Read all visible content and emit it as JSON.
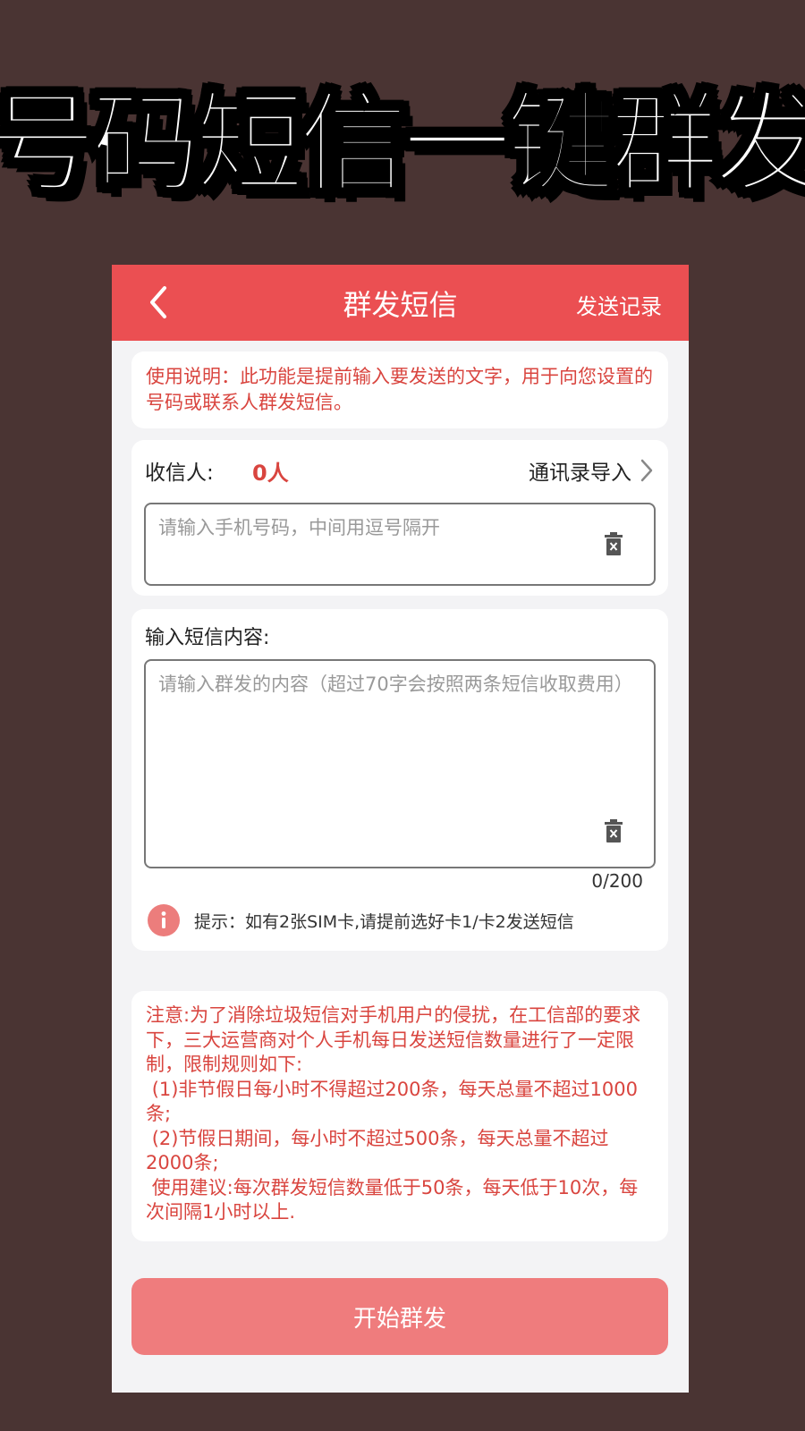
{
  "banner": {
    "title": "号码短信一键群发"
  },
  "header": {
    "title": "群发短信",
    "right_link": "发送记录"
  },
  "instructions": {
    "text": "使用说明：此功能是提前输入要发送的文字，用于向您设置的号码或联系人群发短信。"
  },
  "recipient": {
    "label": "收信人:",
    "count": "0人",
    "import_label": "通讯录导入",
    "phone_placeholder": "请输入手机号码，中间用逗号隔开"
  },
  "content": {
    "label": "输入短信内容:",
    "placeholder": "请输入群发的内容（超过70字会按照两条短信收取费用）",
    "counter": "0/200"
  },
  "tip": {
    "text": "提示：如有2张SIM卡,请提前选好卡1/卡2发送短信"
  },
  "notice": {
    "text": "注意:为了消除垃圾短信对手机用户的侵扰，在工信部的要求下，三大运营商对个人手机每日发送短信数量进行了一定限制，限制规则如下:\n (1)非节假日每小时不得超过200条，每天总量不超过1000条;\n (2)节假日期间，每小时不超过500条，每天总量不超过2000条;\n 使用建议:每次群发短信数量低于50条，每天低于10次，每次间隔1小时以上."
  },
  "start_button": {
    "label": "开始群发"
  },
  "colors": {
    "accent": "#eb4f52",
    "notice_red": "#d9453f",
    "button": "#ef7c7d",
    "background": "#4a3433"
  },
  "icons": [
    "chevron-left-icon",
    "chevron-right-icon",
    "trash-icon",
    "info-icon"
  ]
}
